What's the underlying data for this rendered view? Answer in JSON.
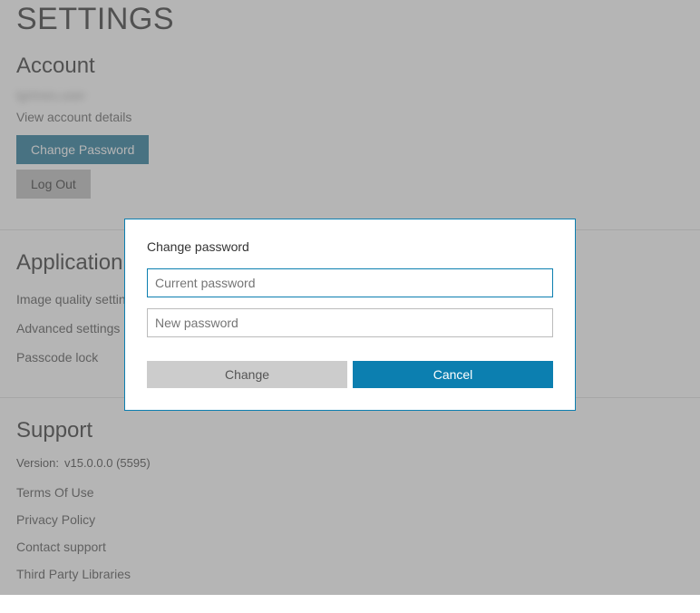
{
  "page_title": "SETTINGS",
  "account": {
    "heading": "Account",
    "username": "lgrimes.user",
    "view_details_label": "View account details",
    "change_password_label": "Change Password",
    "logout_label": "Log Out"
  },
  "application": {
    "heading": "Application",
    "items": [
      "Image quality settings",
      "Advanced settings",
      "Passcode lock"
    ]
  },
  "support": {
    "heading": "Support",
    "version_label": "Version:",
    "version_value": "v15.0.0.0 (5595)",
    "links": [
      "Terms Of Use",
      "Privacy Policy",
      "Contact support",
      "Third Party Libraries"
    ]
  },
  "modal": {
    "title": "Change password",
    "current_placeholder": "Current password",
    "new_placeholder": "New password",
    "change_label": "Change",
    "cancel_label": "Cancel"
  }
}
